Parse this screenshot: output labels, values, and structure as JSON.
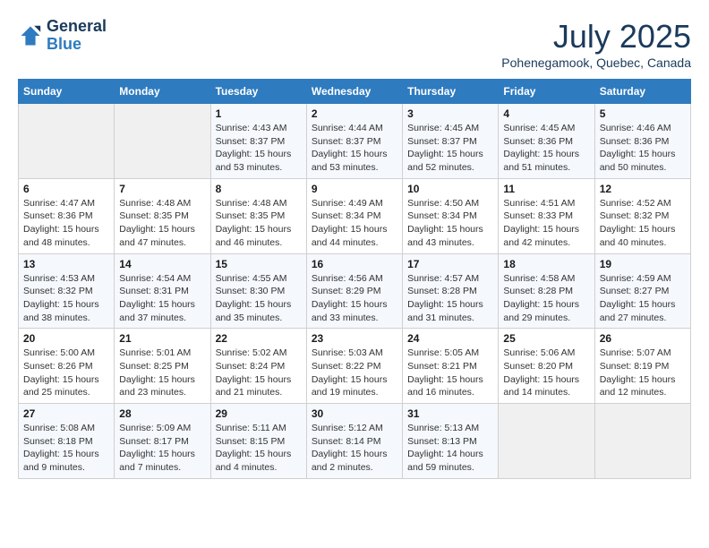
{
  "logo": {
    "line1": "General",
    "line2": "Blue"
  },
  "title": "July 2025",
  "subtitle": "Pohenegamook, Quebec, Canada",
  "days_of_week": [
    "Sunday",
    "Monday",
    "Tuesday",
    "Wednesday",
    "Thursday",
    "Friday",
    "Saturday"
  ],
  "weeks": [
    [
      {
        "day": "",
        "info": ""
      },
      {
        "day": "",
        "info": ""
      },
      {
        "day": "1",
        "info": "Sunrise: 4:43 AM\nSunset: 8:37 PM\nDaylight: 15 hours and 53 minutes."
      },
      {
        "day": "2",
        "info": "Sunrise: 4:44 AM\nSunset: 8:37 PM\nDaylight: 15 hours and 53 minutes."
      },
      {
        "day": "3",
        "info": "Sunrise: 4:45 AM\nSunset: 8:37 PM\nDaylight: 15 hours and 52 minutes."
      },
      {
        "day": "4",
        "info": "Sunrise: 4:45 AM\nSunset: 8:36 PM\nDaylight: 15 hours and 51 minutes."
      },
      {
        "day": "5",
        "info": "Sunrise: 4:46 AM\nSunset: 8:36 PM\nDaylight: 15 hours and 50 minutes."
      }
    ],
    [
      {
        "day": "6",
        "info": "Sunrise: 4:47 AM\nSunset: 8:36 PM\nDaylight: 15 hours and 48 minutes."
      },
      {
        "day": "7",
        "info": "Sunrise: 4:48 AM\nSunset: 8:35 PM\nDaylight: 15 hours and 47 minutes."
      },
      {
        "day": "8",
        "info": "Sunrise: 4:48 AM\nSunset: 8:35 PM\nDaylight: 15 hours and 46 minutes."
      },
      {
        "day": "9",
        "info": "Sunrise: 4:49 AM\nSunset: 8:34 PM\nDaylight: 15 hours and 44 minutes."
      },
      {
        "day": "10",
        "info": "Sunrise: 4:50 AM\nSunset: 8:34 PM\nDaylight: 15 hours and 43 minutes."
      },
      {
        "day": "11",
        "info": "Sunrise: 4:51 AM\nSunset: 8:33 PM\nDaylight: 15 hours and 42 minutes."
      },
      {
        "day": "12",
        "info": "Sunrise: 4:52 AM\nSunset: 8:32 PM\nDaylight: 15 hours and 40 minutes."
      }
    ],
    [
      {
        "day": "13",
        "info": "Sunrise: 4:53 AM\nSunset: 8:32 PM\nDaylight: 15 hours and 38 minutes."
      },
      {
        "day": "14",
        "info": "Sunrise: 4:54 AM\nSunset: 8:31 PM\nDaylight: 15 hours and 37 minutes."
      },
      {
        "day": "15",
        "info": "Sunrise: 4:55 AM\nSunset: 8:30 PM\nDaylight: 15 hours and 35 minutes."
      },
      {
        "day": "16",
        "info": "Sunrise: 4:56 AM\nSunset: 8:29 PM\nDaylight: 15 hours and 33 minutes."
      },
      {
        "day": "17",
        "info": "Sunrise: 4:57 AM\nSunset: 8:28 PM\nDaylight: 15 hours and 31 minutes."
      },
      {
        "day": "18",
        "info": "Sunrise: 4:58 AM\nSunset: 8:28 PM\nDaylight: 15 hours and 29 minutes."
      },
      {
        "day": "19",
        "info": "Sunrise: 4:59 AM\nSunset: 8:27 PM\nDaylight: 15 hours and 27 minutes."
      }
    ],
    [
      {
        "day": "20",
        "info": "Sunrise: 5:00 AM\nSunset: 8:26 PM\nDaylight: 15 hours and 25 minutes."
      },
      {
        "day": "21",
        "info": "Sunrise: 5:01 AM\nSunset: 8:25 PM\nDaylight: 15 hours and 23 minutes."
      },
      {
        "day": "22",
        "info": "Sunrise: 5:02 AM\nSunset: 8:24 PM\nDaylight: 15 hours and 21 minutes."
      },
      {
        "day": "23",
        "info": "Sunrise: 5:03 AM\nSunset: 8:22 PM\nDaylight: 15 hours and 19 minutes."
      },
      {
        "day": "24",
        "info": "Sunrise: 5:05 AM\nSunset: 8:21 PM\nDaylight: 15 hours and 16 minutes."
      },
      {
        "day": "25",
        "info": "Sunrise: 5:06 AM\nSunset: 8:20 PM\nDaylight: 15 hours and 14 minutes."
      },
      {
        "day": "26",
        "info": "Sunrise: 5:07 AM\nSunset: 8:19 PM\nDaylight: 15 hours and 12 minutes."
      }
    ],
    [
      {
        "day": "27",
        "info": "Sunrise: 5:08 AM\nSunset: 8:18 PM\nDaylight: 15 hours and 9 minutes."
      },
      {
        "day": "28",
        "info": "Sunrise: 5:09 AM\nSunset: 8:17 PM\nDaylight: 15 hours and 7 minutes."
      },
      {
        "day": "29",
        "info": "Sunrise: 5:11 AM\nSunset: 8:15 PM\nDaylight: 15 hours and 4 minutes."
      },
      {
        "day": "30",
        "info": "Sunrise: 5:12 AM\nSunset: 8:14 PM\nDaylight: 15 hours and 2 minutes."
      },
      {
        "day": "31",
        "info": "Sunrise: 5:13 AM\nSunset: 8:13 PM\nDaylight: 14 hours and 59 minutes."
      },
      {
        "day": "",
        "info": ""
      },
      {
        "day": "",
        "info": ""
      }
    ]
  ]
}
